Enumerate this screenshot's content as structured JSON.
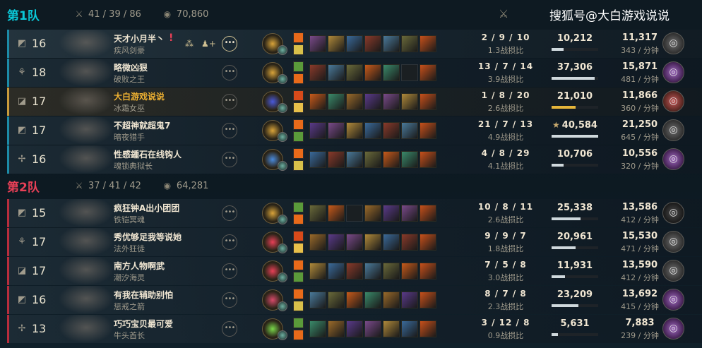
{
  "team1": {
    "label": "第1队",
    "kda": "41 / 39 / 86",
    "gold": "70,860",
    "players": [
      {
        "level": "16",
        "summoner": "天才小月半丶",
        "champion": "疾风剑豪",
        "alert": "!",
        "kda": "2 / 9 / 10",
        "kda_ratio": "1.3战损比",
        "damage": "10,212",
        "damage_pct": 0.25,
        "gold": "11,317",
        "gpm": "343 / 分钟",
        "pos_icon": "top-lane-icon",
        "rune": "#d9a43a",
        "emblem_icon": "ionia-emblem-icon"
      },
      {
        "level": "18",
        "summoner": "略微凶狠",
        "champion": "破败之王",
        "kda": "13 / 7 / 14",
        "kda_ratio": "3.9战损比",
        "damage": "37,306",
        "damage_pct": 0.92,
        "gold": "15,871",
        "gpm": "481 / 分钟",
        "pos_icon": "jungle-icon",
        "rune": "#d9a43a",
        "emblem_icon": "shadow-isles-emblem-icon"
      },
      {
        "level": "17",
        "summoner": "大白游戏说说",
        "champion": "冰霜女巫",
        "kda": "1 / 8 / 20",
        "kda_ratio": "2.6战损比",
        "damage": "21,010",
        "damage_pct": 0.52,
        "gold": "11,866",
        "gpm": "360 / 分钟",
        "pos_icon": "mid-lane-icon",
        "rune": "#4a5adc",
        "emblem_icon": "freljord-emblem-icon"
      },
      {
        "level": "17",
        "summoner": "不超神就超鬼7",
        "champion": "暗夜猎手",
        "kda": "21 / 7 / 13",
        "kda_ratio": "4.9战损比",
        "damage": "40,584",
        "damage_pct": 1.0,
        "star": "★",
        "gold": "21,250",
        "gpm": "645 / 分钟",
        "pos_icon": "bot-lane-icon",
        "rune": "#d9a43a",
        "emblem_icon": "demacia-emblem-icon"
      },
      {
        "level": "16",
        "summoner": "性感鍾石在线钩人",
        "champion": "魂锁典狱长",
        "kda": "4 / 8 / 29",
        "kda_ratio": "4.1战损比",
        "damage": "10,706",
        "damage_pct": 0.26,
        "gold": "10,556",
        "gpm": "320 / 分钟",
        "pos_icon": "support-icon",
        "rune": "#4a8adc",
        "emblem_icon": "shadow-isles-emblem-icon"
      }
    ]
  },
  "team2": {
    "label": "第2队",
    "kda": "37 / 41 / 42",
    "gold": "64,281",
    "players": [
      {
        "level": "15",
        "summoner": "疯狂钟A出小团团",
        "champion": "铁铠冥魂",
        "kda": "10 / 8 / 11",
        "kda_ratio": "2.6战损比",
        "damage": "25,338",
        "damage_pct": 0.62,
        "gold": "13,586",
        "gpm": "412 / 分钟",
        "pos_icon": "top-lane-icon",
        "rune": "#d9a43a",
        "emblem_icon": "noxus-emblem-icon"
      },
      {
        "level": "17",
        "summoner": "秀优够足我等说她",
        "champion": "法外狂徒",
        "kda": "9 / 9 / 7",
        "kda_ratio": "1.8战损比",
        "damage": "20,961",
        "damage_pct": 0.52,
        "gold": "15,530",
        "gpm": "471 / 分钟",
        "pos_icon": "jungle-icon",
        "rune": "#e84057",
        "emblem_icon": "bilgewater-emblem-icon"
      },
      {
        "level": "17",
        "summoner": "南方人物啊武",
        "champion": "潮汐海灵",
        "kda": "7 / 5 / 8",
        "kda_ratio": "3.0战损比",
        "damage": "11,931",
        "damage_pct": 0.29,
        "gold": "13,590",
        "gpm": "412 / 分钟",
        "pos_icon": "mid-lane-icon",
        "rune": "#e84057",
        "emblem_icon": "bilgewater-emblem-icon"
      },
      {
        "level": "16",
        "summoner": "有我在辅助别怕",
        "champion": "惩戒之箭",
        "kda": "8 / 7 / 8",
        "kda_ratio": "2.3战损比",
        "damage": "23,209",
        "damage_pct": 0.57,
        "gold": "13,692",
        "gpm": "415 / 分钟",
        "pos_icon": "bot-lane-icon",
        "rune": "#d84a6a",
        "emblem_icon": "shadow-isles-emblem-icon"
      },
      {
        "level": "13",
        "summoner": "巧巧宝贝最可爱",
        "champion": "牛头酋长",
        "kda": "3 / 12 / 8",
        "kda_ratio": "0.9战损比",
        "damage": "5,631",
        "damage_pct": 0.14,
        "gold": "7,883",
        "gpm": "239 / 分钟",
        "pos_icon": "support-icon",
        "rune": "#7ad84a",
        "emblem_icon": "shadow-isles-emblem-icon"
      }
    ]
  },
  "watermark": "搜狐号@大白游戏说说",
  "colors": {
    "team1_accent": "#0ac8d8",
    "team2_accent": "#e84057",
    "self_accent": "#c89b3c",
    "gold_text": "#f0b232"
  }
}
